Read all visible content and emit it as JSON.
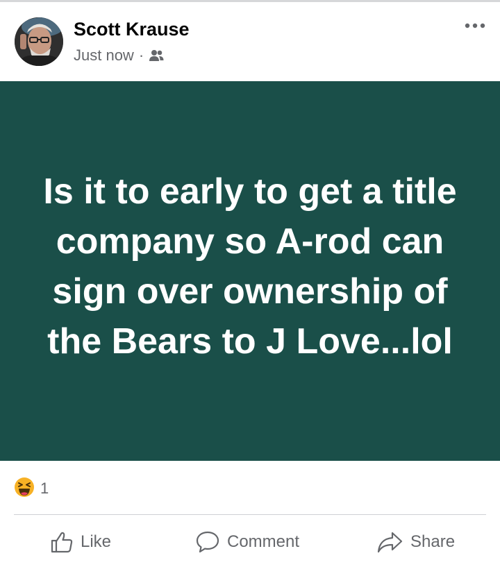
{
  "post": {
    "author": "Scott Krause",
    "timestamp": "Just now",
    "separator": "·",
    "audience_icon": "friends-icon",
    "more_icon": "more-options-icon",
    "body": "Is it to early to get a title company so A-rod can sign over ownership of the Bears to J Love...lol",
    "background_color": "#1a4f49",
    "text_color": "#ffffff"
  },
  "reactions": {
    "icon": "laughing-emoji-icon",
    "count": "1"
  },
  "actions": {
    "like_label": "Like",
    "comment_label": "Comment",
    "share_label": "Share",
    "icon_color": "#65676b"
  }
}
